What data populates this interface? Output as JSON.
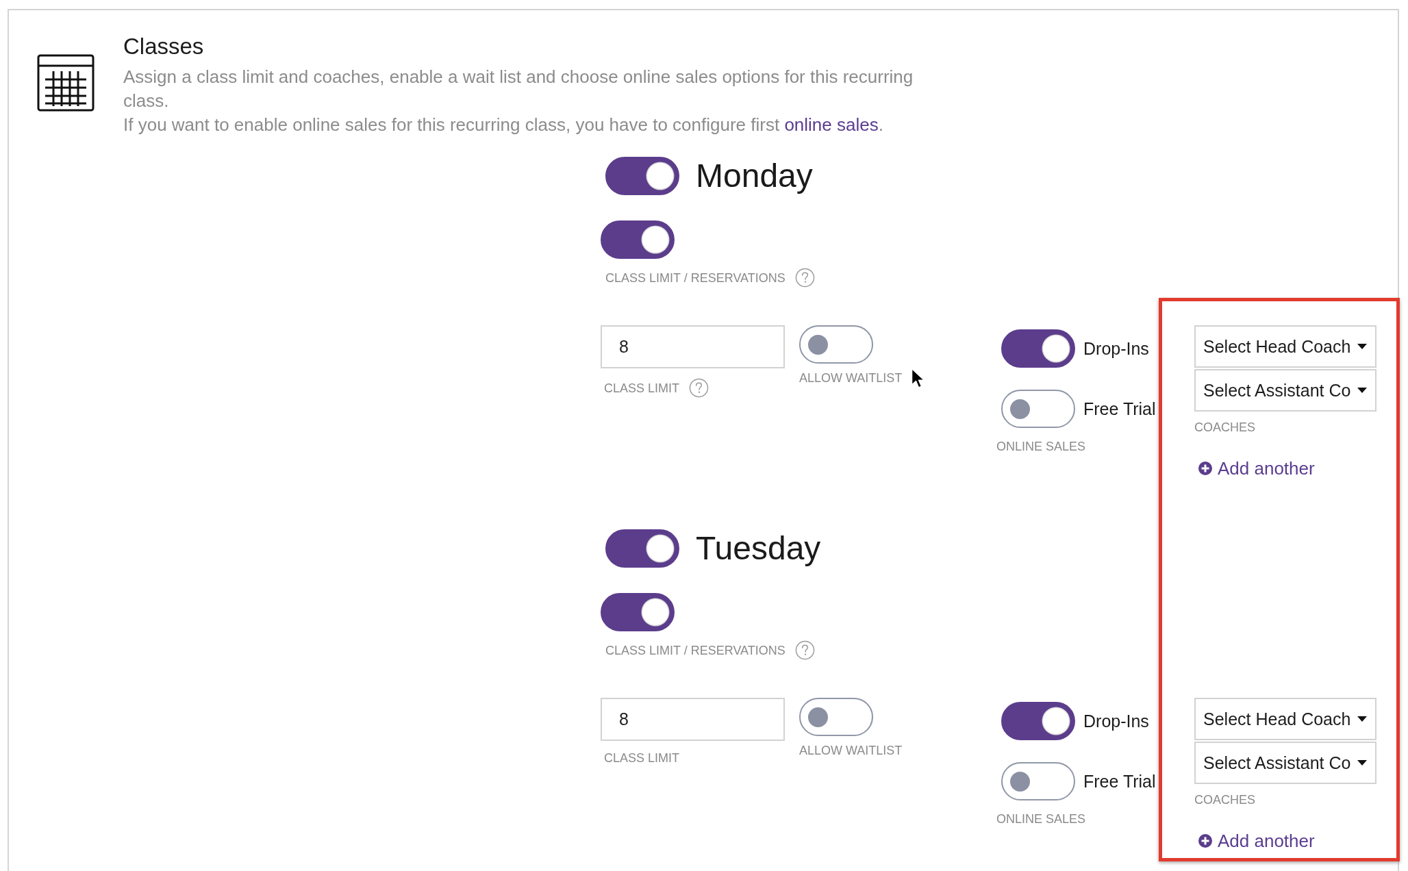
{
  "section": {
    "title": "Classes",
    "description": "Assign a class limit and coaches, enable a wait list and choose online sales options for this recurring class.",
    "note": {
      "text": "If you want to enable online sales for this recurring class, you have to configure first",
      "link": "online sales",
      "end": "."
    }
  },
  "days": [
    {
      "name": "Monday",
      "enabled": true,
      "reservations": {
        "on": true,
        "label": "CLASS LIMIT / RESERVATIONS"
      },
      "class_limit": {
        "value": "8",
        "label": "CLASS LIMIT",
        "help": true
      },
      "waitlist": {
        "on": false,
        "label": "ALLOW WAITLIST"
      },
      "online_sales": {
        "label": "ONLINE SALES",
        "options": [
          {
            "label": "Drop-Ins",
            "on": true
          },
          {
            "label": "Free Trial",
            "on": false
          }
        ]
      },
      "coaches": {
        "label": "COACHES",
        "selects": [
          {
            "value": "Select Head Coach"
          },
          {
            "value": "Select Assistant Co"
          }
        ],
        "add_link": "Add another"
      }
    },
    {
      "name": "Tuesday",
      "enabled": true,
      "reservations": {
        "on": true,
        "label": "CLASS LIMIT / RESERVATIONS"
      },
      "class_limit": {
        "value": "8",
        "label": "CLASS LIMIT",
        "help": false
      },
      "waitlist": {
        "on": false,
        "label": "ALLOW WAITLIST"
      },
      "online_sales": {
        "label": "ONLINE SALES",
        "options": [
          {
            "label": "Drop-Ins",
            "on": true
          },
          {
            "label": "Free Trial",
            "on": false
          }
        ]
      },
      "coaches": {
        "label": "COACHES",
        "selects": [
          {
            "value": "Select Head Coach"
          },
          {
            "value": "Select Assistant Co"
          }
        ],
        "add_link": "Add another"
      }
    }
  ]
}
